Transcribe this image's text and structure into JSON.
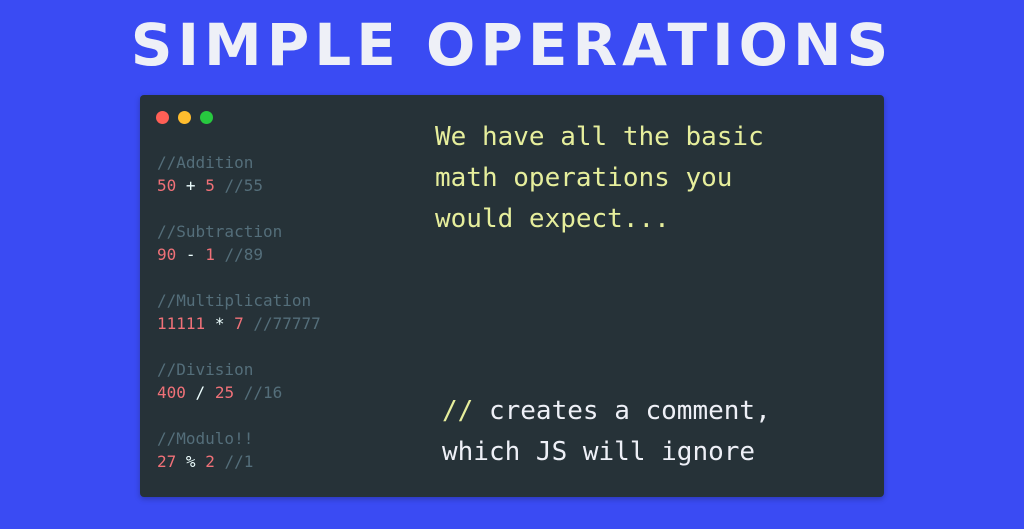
{
  "title": "SIMPLE OPERATIONS",
  "window": {
    "controls": [
      "close",
      "minimize",
      "maximize"
    ]
  },
  "code": {
    "addition": {
      "comment": "//Addition",
      "a": "50",
      "op": "+",
      "b": "5",
      "result": "//55"
    },
    "subtraction": {
      "comment": "//Subtraction",
      "a": "90",
      "op": "-",
      "b": "1",
      "result": "//89"
    },
    "multiplication": {
      "comment": "//Multiplication",
      "a": "11111",
      "op": "*",
      "b": "7",
      "result": "//77777"
    },
    "division": {
      "comment": "//Division",
      "a": "400",
      "op": "/",
      "b": "25",
      "result": "//16"
    },
    "modulo": {
      "comment": "//Modulo!!",
      "a": "27",
      "op": "%",
      "b": "2",
      "result": "//1"
    }
  },
  "description": {
    "line1": "We have all the basic",
    "line2": "math operations you",
    "line3": "would expect..."
  },
  "note": {
    "slashes": "//",
    "line1_rest": "creates a comment,",
    "line2": "which JS will ignore"
  },
  "colors": {
    "background": "#3a4bf3",
    "window": "#263238",
    "comment": "#546e7a",
    "number": "#f07178",
    "highlight": "#e6ee9c"
  }
}
